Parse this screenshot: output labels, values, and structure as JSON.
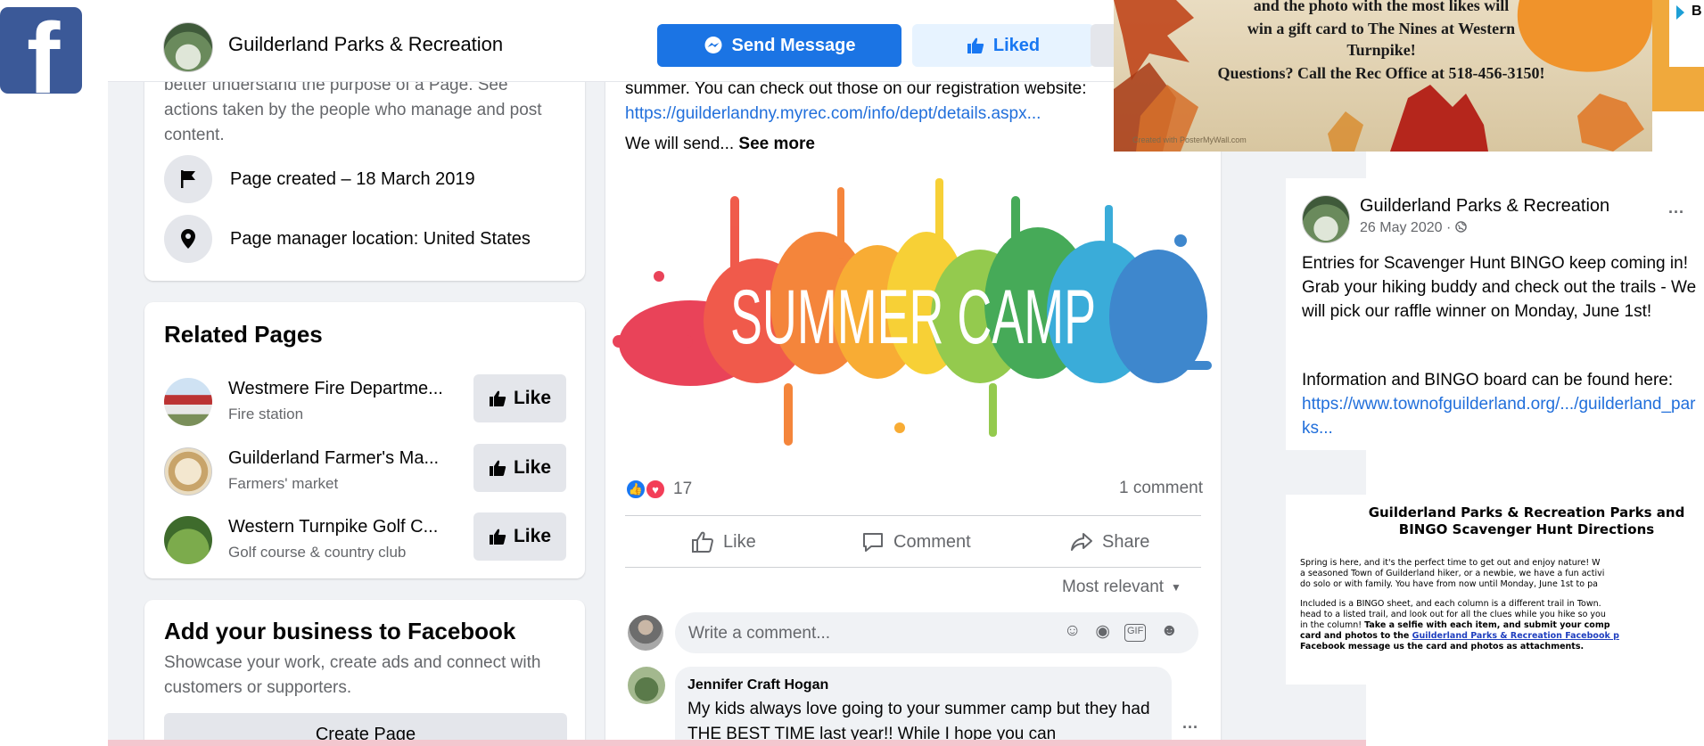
{
  "brand": {
    "logo_letter": "f",
    "color": "#3b5998"
  },
  "header": {
    "page_name": "Guilderland Parks & Recreation",
    "send_message": "Send Message",
    "liked": "Liked"
  },
  "transparency": {
    "text": "better understand the purpose of a Page. See actions taken by the people who manage and post content.",
    "rows": [
      {
        "icon": "flag-icon",
        "label": "Page created – 18 March 2019"
      },
      {
        "icon": "location-pin-icon",
        "label": "Page manager location: United States"
      }
    ]
  },
  "related": {
    "title": "Related Pages",
    "like_label": "Like",
    "items": [
      {
        "name": "Westmere Fire Departme...",
        "category": "Fire station"
      },
      {
        "name": "Guilderland Farmer's Ma...",
        "category": "Farmers' market"
      },
      {
        "name": "Western Turnpike Golf C...",
        "category": "Golf course & country club"
      }
    ]
  },
  "business": {
    "title": "Add your business to Facebook",
    "desc": "Showcase your work, create ads and connect with customers or supporters.",
    "button": "Create Page"
  },
  "post": {
    "text_line": "summer. You can check out those on our registration website:",
    "link": "https://guilderlandny.myrec.com/info/dept/details.aspx...",
    "send_prefix": "We will send...",
    "see_more": "See more",
    "image_text": "SUMMER CAMP",
    "reaction_count": "17",
    "comment_count": "1 comment",
    "actions": {
      "like": "Like",
      "comment": "Comment",
      "share": "Share"
    },
    "most_relevant": "Most relevant",
    "write_placeholder": "Write a comment...",
    "comment": {
      "author": "Jennifer Craft Hogan",
      "text": "My kids always love going to your summer camp but they had THE BEST TIME last year!! While I hope you can"
    }
  },
  "banner": {
    "line1": "and the photo with the most likes will",
    "line2": "win a gift card to The Nines at Western",
    "line3": "Turnpike!",
    "line4": "Questions? Call the Rec Office at 518-456-3150!",
    "credit": "Created with PosterMyWall.com"
  },
  "top_right": {
    "letter": "B"
  },
  "right_post": {
    "name": "Guilderland Parks & Recreation",
    "date": "26 May 2020 · ",
    "body": "Entries for Scavenger Hunt BINGO keep coming in! Grab your hiking buddy and check out the trails - We will pick our raffle winner on Monday, June 1st!",
    "info": "Information and BINGO board can be found here:",
    "link": "https://www.townofguilderland.org/.../guilderland_parks..."
  },
  "bingo_doc": {
    "title1": "Guilderland Parks & Recreation Parks and",
    "title2": "BINGO Scavenger Hunt Directions",
    "p1a": "Spring is here, and it's the perfect time to get out and enjoy nature!  W",
    "p1b": "a seasoned Town of Guilderland hiker, or a newbie, we have a fun activi",
    "p1c": "do solo or with family.  You have from now until Monday, June 1st to pa",
    "p2a": "Included is a BINGO sheet, and each column is a different trail in Town.",
    "p2b": "head to a listed trail, and look out for all the clues while you hike so you",
    "p2c_plain": "in the column!  ",
    "p2c_bold": "Take a selfie with each item, and submit your comp",
    "p2d_bold": "card and photos to the ",
    "p2d_link": "Guilderland Parks & Recreation Facebook p",
    "p2e_bold": "Facebook message us the card and photos as attachments."
  }
}
